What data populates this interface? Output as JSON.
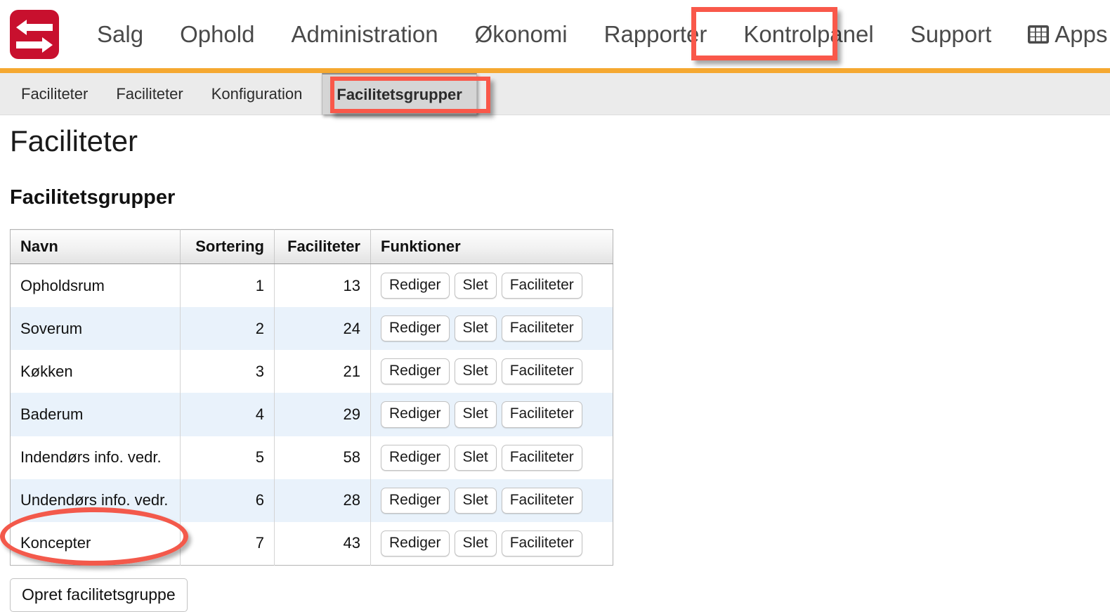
{
  "brand": {
    "logo_name": "superoffice-style-logo",
    "logo_color": "#c8102e"
  },
  "topnav": {
    "items": [
      {
        "label": "Salg",
        "name": "nav-salg",
        "highlighted": false
      },
      {
        "label": "Ophold",
        "name": "nav-ophold",
        "highlighted": false
      },
      {
        "label": "Administration",
        "name": "nav-administration",
        "highlighted": false
      },
      {
        "label": "Økonomi",
        "name": "nav-okonomi",
        "highlighted": false
      },
      {
        "label": "Rapporter",
        "name": "nav-rapporter",
        "highlighted": false
      },
      {
        "label": "Kontrolpanel",
        "name": "nav-kontrolpanel",
        "highlighted": true
      },
      {
        "label": "Support",
        "name": "nav-support",
        "highlighted": false
      },
      {
        "label": "Apps",
        "name": "nav-apps",
        "icon": "apps-grid-icon",
        "highlighted": false
      }
    ],
    "accent_bar_color": "#f5a831"
  },
  "subnav": {
    "items": [
      {
        "label": "Faciliteter",
        "name": "subtab-faciliteter-1",
        "active": false
      },
      {
        "label": "Faciliteter",
        "name": "subtab-faciliteter-2",
        "active": false
      },
      {
        "label": "Konfiguration",
        "name": "subtab-konfiguration",
        "active": false
      },
      {
        "label": "Facilitetsgrupper",
        "name": "subtab-facilitetsgrupper",
        "active": true
      }
    ]
  },
  "page": {
    "title": "Faciliteter",
    "section_title": "Facilitetsgrupper"
  },
  "table": {
    "headers": [
      "Navn",
      "Sortering",
      "Faciliteter",
      "Funktioner"
    ],
    "action_labels": {
      "edit": "Rediger",
      "delete": "Slet",
      "facilities": "Faciliteter"
    },
    "rows": [
      {
        "navn": "Opholdsrum",
        "sortering": "1",
        "faciliteter": "13"
      },
      {
        "navn": "Soverum",
        "sortering": "2",
        "faciliteter": "24"
      },
      {
        "navn": "Køkken",
        "sortering": "3",
        "faciliteter": "21"
      },
      {
        "navn": "Baderum",
        "sortering": "4",
        "faciliteter": "29"
      },
      {
        "navn": "Indendørs info. vedr.",
        "sortering": "5",
        "faciliteter": "58"
      },
      {
        "navn": "Undendørs info. vedr.",
        "sortering": "6",
        "faciliteter": "28"
      },
      {
        "navn": "Koncepter",
        "sortering": "7",
        "faciliteter": "43"
      }
    ]
  },
  "footer": {
    "create_label": "Opret facilitetsgruppe"
  },
  "annotations": {
    "color": "#f9584a",
    "box_kontrolpanel": "highlight-rectangle",
    "box_facilitetsgrupper": "highlight-rectangle",
    "ellipse_create": "highlight-ellipse"
  }
}
